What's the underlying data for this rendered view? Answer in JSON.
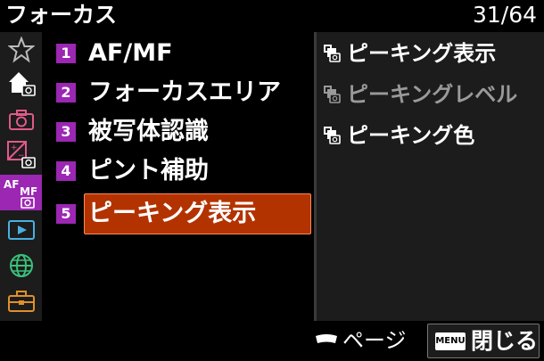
{
  "header": {
    "title": "フォーカス",
    "page_indicator": "31/64"
  },
  "sidebar": {
    "items": [
      {
        "icon": "star-icon",
        "active": false
      },
      {
        "icon": "home-camera-icon",
        "active": false
      },
      {
        "icon": "camera-icon",
        "active": false
      },
      {
        "icon": "exposure-camera-icon",
        "active": false
      },
      {
        "icon": "af-mf-camera-icon",
        "label": "AF MF",
        "active": true
      },
      {
        "icon": "playback-icon",
        "active": false
      },
      {
        "icon": "network-globe-icon",
        "active": false
      },
      {
        "icon": "toolbox-icon",
        "active": false
      }
    ]
  },
  "menu": {
    "items": [
      {
        "num": "1",
        "label": "AF/MF"
      },
      {
        "num": "2",
        "label": "フォーカスエリア"
      },
      {
        "num": "3",
        "label": "被写体認識"
      },
      {
        "num": "4",
        "label": "ピント補助"
      },
      {
        "num": "5",
        "label": "ピーキング表示",
        "selected": true
      }
    ]
  },
  "submenu": {
    "items": [
      {
        "label": "ピーキング表示",
        "dim": false
      },
      {
        "label": "ピーキングレベル",
        "dim": true
      },
      {
        "label": "ピーキング色",
        "dim": false
      }
    ]
  },
  "footer": {
    "page_hint": "ページ",
    "menu_badge": "MENU",
    "close_label": "閉じる"
  },
  "colors": {
    "accent_purple": "#9b27b3",
    "selection_orange": "#b33300",
    "panel_gray": "#1c1c1c"
  }
}
